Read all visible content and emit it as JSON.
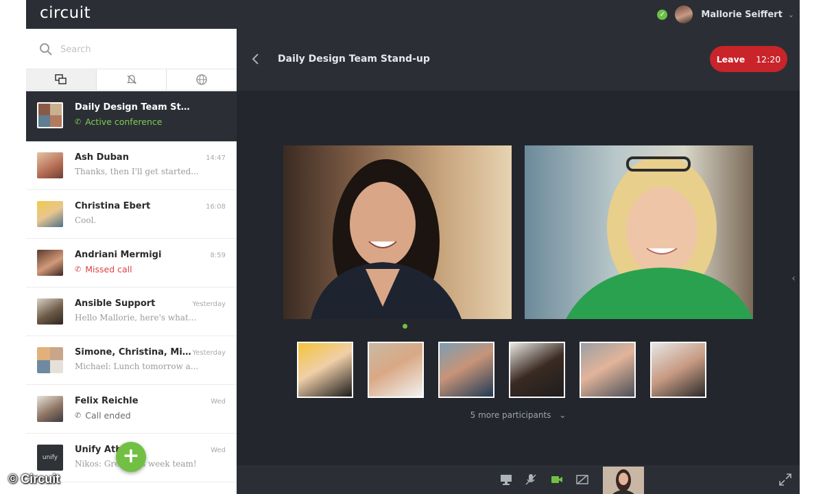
{
  "app": {
    "logo": "circuit"
  },
  "user": {
    "name": "Mallorie Seiffert",
    "status": "available",
    "chevron": "⌄"
  },
  "search": {
    "placeholder": "Search"
  },
  "tabs": [
    {
      "name": "conversations-icon",
      "active": true
    },
    {
      "name": "muted-bell-icon",
      "active": false
    },
    {
      "name": "globe-icon",
      "active": false
    }
  ],
  "conversations": [
    {
      "name": "Daily Design Team Stand-up",
      "status": "Active conference",
      "status_color": "green",
      "time": "",
      "active": true
    },
    {
      "name": "Ash Duban",
      "snippet": "Thanks, then I'll get started...",
      "time": "14:47"
    },
    {
      "name": "Christina Ebert",
      "snippet": "Cool.",
      "time": "16:08"
    },
    {
      "name": "Andriani Mermigi",
      "status": "Missed call",
      "status_color": "red",
      "time": "8:59"
    },
    {
      "name": "Ansible Support",
      "snippet": "Hello Mallorie, here's what...",
      "time": "Yesterday"
    },
    {
      "name": "Simone, Christina, Mic...",
      "snippet": "Michael: Lunch tomorrow a...",
      "time": "Yesterday"
    },
    {
      "name": "Felix Reichle",
      "status": "Call ended",
      "status_color": "gray",
      "time": "Wed"
    },
    {
      "name": "Unify Ath",
      "snippet": "Nikos: Gre... this week team!",
      "time": "Wed",
      "avatar_text": "unify"
    }
  ],
  "fab": {
    "label": "+"
  },
  "conference": {
    "title": "Daily Design Team Stand-up",
    "leave_label": "Leave",
    "timer": "12:20",
    "more_participants": "5 more participants",
    "participant_thumbs": 6
  },
  "watermark": "© Circuit",
  "colors": {
    "accent_green": "#72c043",
    "leave_red": "#c8242a",
    "dark_bg": "#23272d",
    "header_bg": "#2b2f35"
  }
}
